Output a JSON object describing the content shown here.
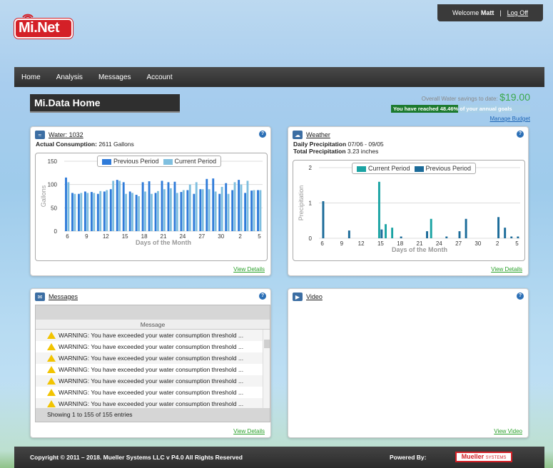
{
  "header": {
    "logo_text": "Mi.Net",
    "welcome_prefix": "Welcome",
    "username": "Matt",
    "logoff": "Log Off"
  },
  "nav": [
    {
      "label": "Home"
    },
    {
      "label": "Analysis"
    },
    {
      "label": "Messages"
    },
    {
      "label": "Account"
    }
  ],
  "page_title": "Mi.Data Home",
  "savings": {
    "label": "Overall Water savings to date:",
    "amount": "$19.00",
    "goal_text": "You have reached 48.46% of your annual goals",
    "goal_fraction": 0.4846,
    "manage_budget": "Manage Budget"
  },
  "water": {
    "title": "Water: 1032",
    "consumption_label": "Actual Consumption:",
    "consumption_value": "2611 Gallons",
    "view_details": "View Details"
  },
  "weather": {
    "title": "Weather",
    "daily_label": "Daily Precipitation",
    "daily_range": "07/06 - 09/05",
    "total_label": "Total Precipitation",
    "total_value": "3.23 inches",
    "view_details": "View Details"
  },
  "messages": {
    "title": "Messages",
    "column": "Message",
    "rows": [
      "WARNING: You have exceeded your water consumption threshold ...",
      "WARNING: You have exceeded your water consumption threshold ...",
      "WARNING: You have exceeded your water consumption threshold ...",
      "WARNING: You have exceeded your water consumption threshold ...",
      "WARNING: You have exceeded your water consumption threshold ...",
      "WARNING: You have exceeded your water consumption threshold ...",
      "WARNING: You have exceeded your water consumption threshold ..."
    ],
    "footer": "Showing 1 to 155 of 155 entries",
    "view_details": "View Details"
  },
  "video": {
    "title": "Video",
    "view_video": "View Video"
  },
  "footer": {
    "copyright": "Copyright © 2011 – 2018. Mueller Systems LLC v P4.0 All Rights Reserved",
    "powered_by": "Powered By:",
    "brand": "Mueller",
    "brand_suffix": "SYSTEMS"
  },
  "colors": {
    "prev": "#2f7bd9",
    "cur": "#7fbfdf",
    "w_cur": "#1aa3a3",
    "w_prev": "#1b6b99"
  },
  "chart_data": [
    {
      "type": "bar",
      "xlabel": "Days of the Month",
      "ylabel": "Gallons",
      "ylim": [
        0,
        150
      ],
      "yticks": [
        0,
        50,
        100,
        150
      ],
      "xticks": [
        "6",
        "9",
        "12",
        "15",
        "18",
        "21",
        "24",
        "27",
        "30",
        "2",
        "5"
      ],
      "series": [
        {
          "name": "Previous Period",
          "values": [
            115,
            82,
            80,
            85,
            84,
            80,
            85,
            90,
            110,
            105,
            85,
            78,
            105,
            107,
            82,
            108,
            105,
            106,
            84,
            88,
            80,
            90,
            112,
            113,
            80,
            103,
            88,
            110,
            82,
            87,
            88
          ]
        },
        {
          "name": "Current Period",
          "values": [
            105,
            80,
            82,
            82,
            82,
            86,
            88,
            108,
            108,
            80,
            82,
            75,
            85,
            80,
            86,
            90,
            92,
            82,
            88,
            100,
            105,
            90,
            90,
            85,
            95,
            80,
            105,
            100,
            108,
            88,
            88
          ]
        }
      ]
    },
    {
      "type": "bar",
      "xlabel": "Days of the Month",
      "ylabel": "Precipitation",
      "ylim": [
        0,
        2
      ],
      "yticks": [
        0,
        1,
        2
      ],
      "xticks": [
        "6",
        "9",
        "12",
        "15",
        "18",
        "21",
        "24",
        "27",
        "30",
        "2",
        "5"
      ],
      "series": [
        {
          "name": "Current Period",
          "values": [
            0,
            0,
            0,
            0,
            0,
            0,
            0,
            0,
            0,
            1.6,
            0.4,
            0.3,
            0,
            0,
            0,
            0,
            0,
            0.55,
            0,
            0,
            0,
            0,
            0,
            0,
            0,
            0,
            0,
            0,
            0,
            0,
            0
          ]
        },
        {
          "name": "Previous Period",
          "values": [
            1.05,
            0,
            0,
            0,
            0.22,
            0,
            0,
            0,
            0,
            0.25,
            0,
            0,
            0.05,
            0,
            0,
            0,
            0.2,
            0,
            0,
            0.05,
            0,
            0.2,
            0.55,
            0,
            0,
            0,
            0,
            0.6,
            0.3,
            0.05,
            0.05
          ]
        }
      ]
    }
  ]
}
